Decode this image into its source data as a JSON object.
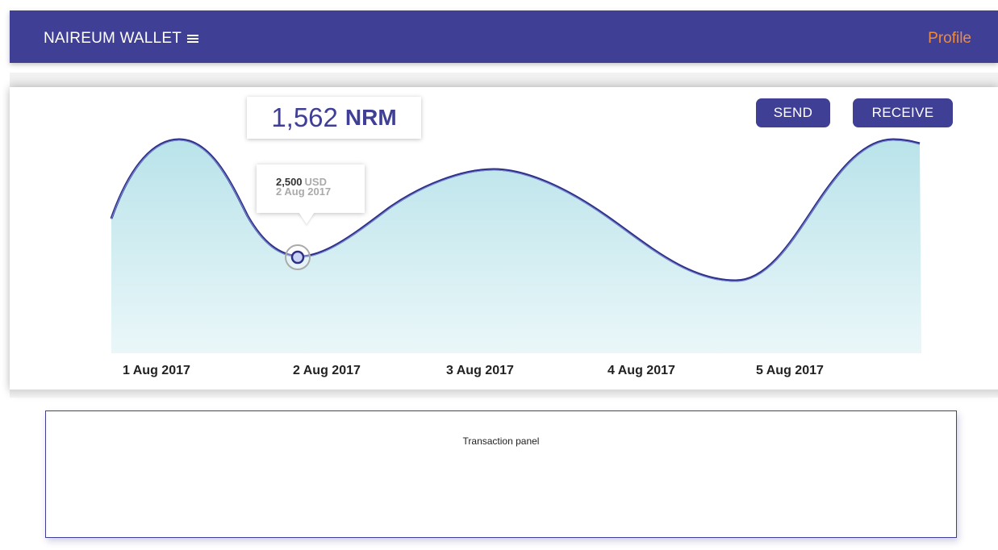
{
  "header": {
    "app_title": "NAIREUM WALLET",
    "menu_icon": "hamburger-menu-icon",
    "profile_label": "Profile",
    "background_color": "#3f3f95",
    "profile_color": "#f08a3c"
  },
  "balance": {
    "amount": "1,562",
    "unit": "NRM"
  },
  "actions": {
    "send_label": "SEND",
    "receive_label": "RECEIVE"
  },
  "tooltip": {
    "value": "2,500",
    "currency": "USD",
    "date": "2 Aug 2017"
  },
  "chart_data": {
    "type": "area",
    "x": [
      "1 Aug 2017",
      "2 Aug 2017",
      "3 Aug 2017",
      "4 Aug 2017",
      "5 Aug 2017"
    ],
    "line_color": "#3f3f95",
    "fill_color": "#bfe6ec",
    "highlighted_point": {
      "x": "2 Aug 2017",
      "value": 2500,
      "unit": "USD"
    }
  },
  "transactions": {
    "panel_label": "Transaction panel"
  }
}
